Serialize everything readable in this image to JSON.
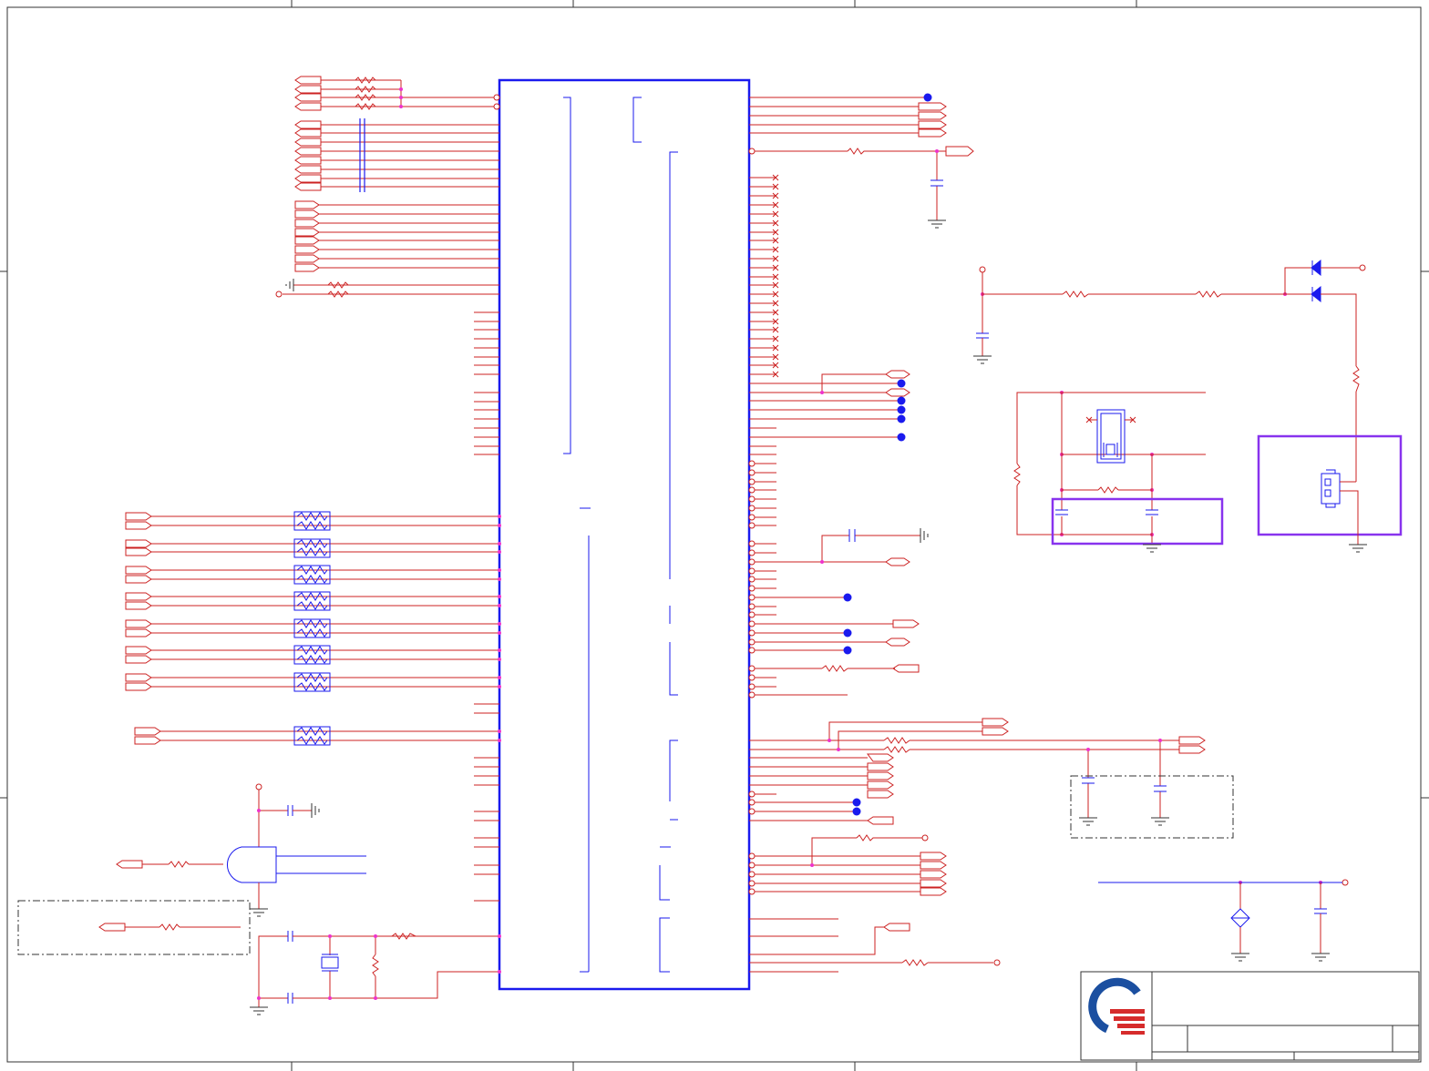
{
  "sheet": {
    "type": "electronic-schematic",
    "visible_text": [],
    "colors": {
      "wire": "#cc2222",
      "component": "#2222cc",
      "bus": "#1a1aee",
      "highlight": "#8833ee",
      "junction": "#ee33cc",
      "net_dot": "#1a1aee",
      "frame": "#333333",
      "logo_blue": "#1b4fa0",
      "logo_red": "#d62b2b"
    },
    "icons": [
      "ic-chip",
      "resistor-symbol",
      "capacitor-symbol",
      "ferrite-bead-symbol",
      "crystal-symbol",
      "diode-symbol",
      "ground-symbol",
      "and-gate-symbol",
      "connector-symbol",
      "company-logo"
    ]
  }
}
